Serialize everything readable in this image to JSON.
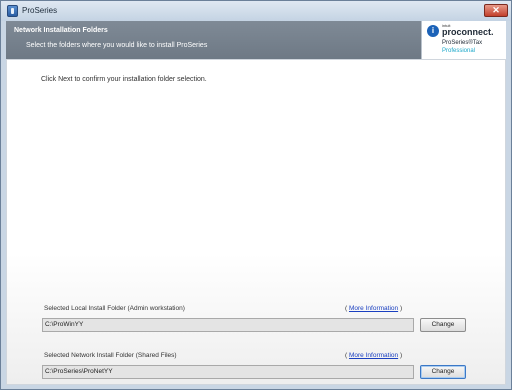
{
  "window": {
    "title": "ProSeries",
    "close_symbol": "✕"
  },
  "header": {
    "title": "Network Installation Folders",
    "subtitle": "Select the folders where you would like to install ProSeries"
  },
  "logo": {
    "mark": "i",
    "intuit": "intuit",
    "brand": "proconnect.",
    "product": "ProSeries®Tax",
    "edition": "Professional"
  },
  "main": {
    "intro": "Click Next to confirm your installation folder selection."
  },
  "local_folder": {
    "label": "Selected Local Install Folder (Admin workstation)",
    "more_info_open": "(",
    "more_info_link": "More Information",
    "more_info_close": ")",
    "path": "C:\\ProWinYY",
    "change_label": "Change"
  },
  "network_folder": {
    "label": "Selected Network Install Folder (Shared Files)",
    "more_info_open": "(",
    "more_info_link": "More Information",
    "more_info_close": ")",
    "path": "C:\\ProSeries\\ProNetYY",
    "change_label": "Change"
  }
}
